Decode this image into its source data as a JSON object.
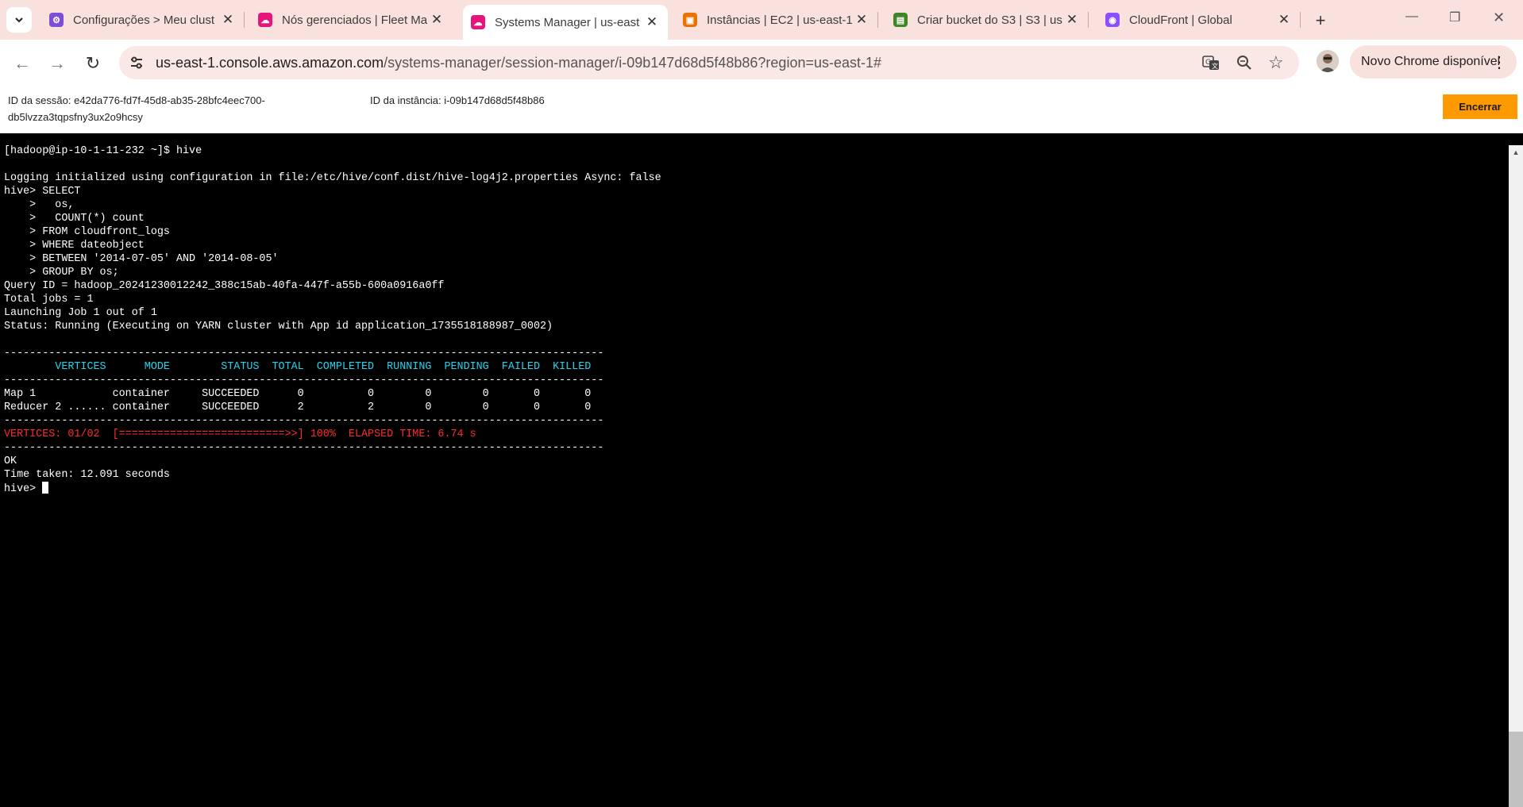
{
  "browser": {
    "tabs": [
      {
        "title": "Configurações > Meu clust",
        "favicon_color": "#7b4fd6",
        "icon": "aws-config-icon"
      },
      {
        "title": "Nós gerenciados | Fleet Ma",
        "favicon_color": "#e7157b",
        "icon": "systems-manager-icon"
      },
      {
        "title": "Systems Manager | us-east",
        "favicon_color": "#e7157b",
        "icon": "systems-manager-icon"
      },
      {
        "title": "Instâncias | EC2 | us-east-1",
        "favicon_color": "#ed7100",
        "icon": "ec2-icon"
      },
      {
        "title": "Criar bucket do S3 | S3 | us",
        "favicon_color": "#3f8624",
        "icon": "s3-icon"
      },
      {
        "title": "CloudFront | Global",
        "favicon_color": "#8c4fff",
        "icon": "cloudfront-icon"
      }
    ],
    "active_tab_index": 2,
    "url_host": "us-east-1.console.aws.amazon.com",
    "url_path": "/systems-manager/session-manager/i-09b147d68d5f48b86?region=us-east-1#",
    "update_label": "Novo Chrome disponível"
  },
  "session": {
    "session_id_line1": "ID da sessão: e42da776-fd7f-45d8-ab35-28bfc4eec700-",
    "session_id_line2": "db5lvzza3tqpsfny3ux2o9hcsy",
    "instance_id": "ID da instância: i-09b147d68d5f48b86",
    "end_button": "Encerrar",
    "end_button_color": "#ff9900"
  },
  "terminal": {
    "lines_before_table": [
      "[hadoop@ip-10-1-11-232 ~]$ hive",
      "",
      "Logging initialized using configuration in file:/etc/hive/conf.dist/hive-log4j2.properties Async: false",
      "hive> SELECT",
      "    >   os,",
      "    >   COUNT(*) count",
      "    > FROM cloudfront_logs",
      "    > WHERE dateobject",
      "    > BETWEEN '2014-07-05' AND '2014-08-05'",
      "    > GROUP BY os;",
      "Query ID = hadoop_20241230012242_388c15ab-40fa-447f-a55b-600a0916a0ff",
      "Total jobs = 1",
      "Launching Job 1 out of 1",
      "Status: Running (Executing on YARN cluster with App id application_1735518188987_0002)",
      ""
    ],
    "rule": "----------------------------------------------------------------------------------------------",
    "table_header": "        VERTICES      MODE        STATUS  TOTAL  COMPLETED  RUNNING  PENDING  FAILED  KILLED",
    "table_rows": [
      "Map 1            container     SUCCEEDED      0          0        0        0       0       0",
      "Reducer 2 ...... container     SUCCEEDED      2          2        0        0       0       0"
    ],
    "progress_line": "VERTICES: 01/02  [==========================>>] 100%  ELAPSED TIME: 6.74 s",
    "lines_after_table": [
      "OK",
      "Time taken: 12.091 seconds"
    ],
    "prompt": "hive> "
  }
}
